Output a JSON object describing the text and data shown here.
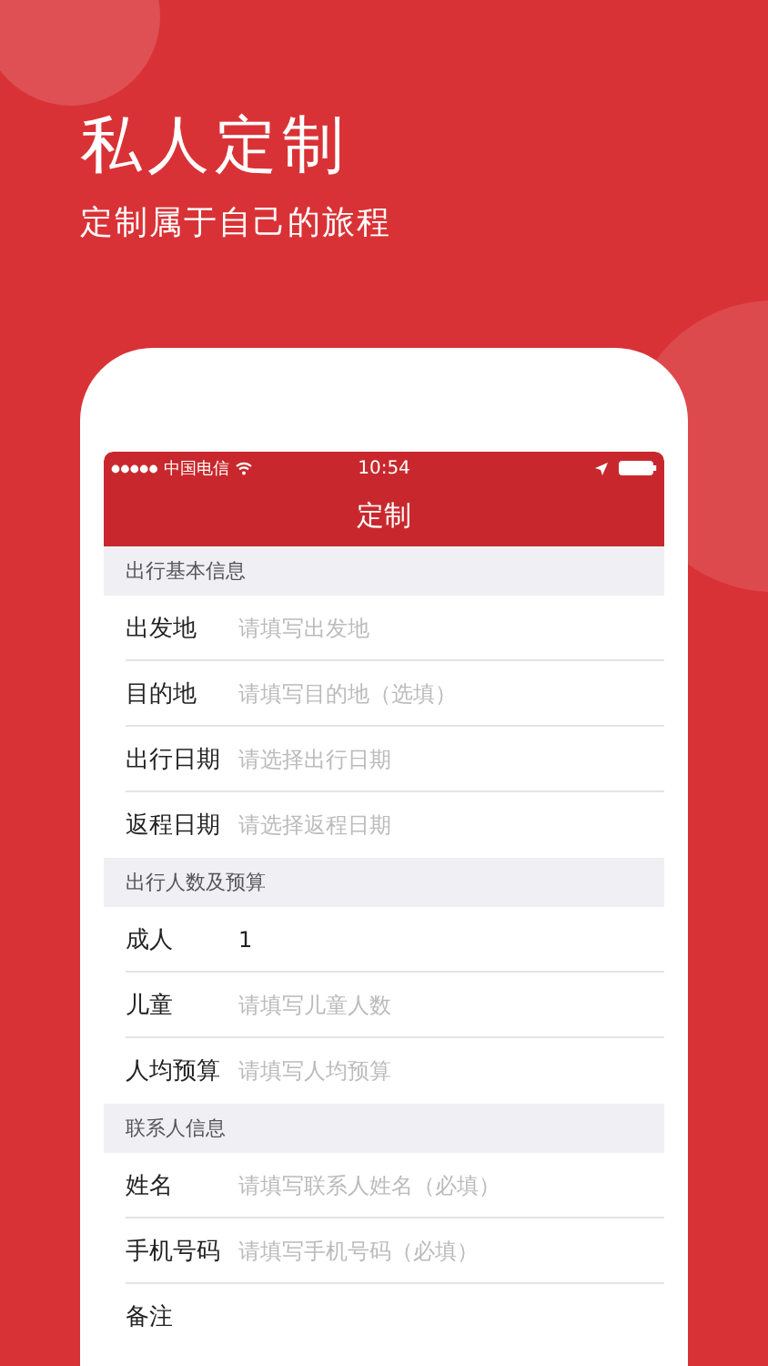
{
  "headline": "私人定制",
  "subtitle": "定制属于自己的旅程",
  "status_bar": {
    "carrier": "中国电信",
    "time": "10:54"
  },
  "nav_bar": {
    "title": "定制"
  },
  "sections": [
    {
      "title": "出行基本信息",
      "fields": [
        {
          "label": "出发地",
          "placeholder": "请填写出发地"
        },
        {
          "label": "目的地",
          "placeholder": "请填写目的地（选填）"
        },
        {
          "label": "出行日期",
          "placeholder": "请选择出行日期"
        },
        {
          "label": "返程日期",
          "placeholder": "请选择返程日期"
        }
      ]
    },
    {
      "title": "出行人数及预算",
      "fields": [
        {
          "label": "成人",
          "value": "1"
        },
        {
          "label": "儿童",
          "placeholder": "请填写儿童人数"
        },
        {
          "label": "人均预算",
          "placeholder": "请填写人均预算"
        }
      ]
    },
    {
      "title": "联系人信息",
      "fields": [
        {
          "label": "姓名",
          "placeholder": "请填写联系人姓名（必填）"
        },
        {
          "label": "手机号码",
          "placeholder": "请填写手机号码（必填）"
        },
        {
          "label": "备注"
        }
      ]
    }
  ]
}
